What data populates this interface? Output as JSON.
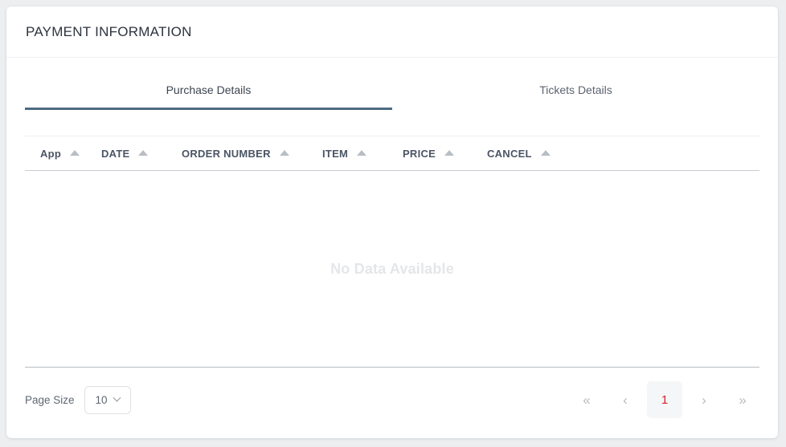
{
  "card": {
    "title": "PAYMENT INFORMATION"
  },
  "tabs": [
    {
      "label": "Purchase Details",
      "active": true
    },
    {
      "label": "Tickets Details",
      "active": false
    }
  ],
  "table": {
    "columns": [
      {
        "label": "App",
        "sort_icon": "sort-ascending-icon"
      },
      {
        "label": "DATE",
        "sort_icon": "sort-ascending-icon"
      },
      {
        "label": "ORDER NUMBER",
        "sort_icon": "sort-ascending-icon"
      },
      {
        "label": "ITEM",
        "sort_icon": "sort-ascending-icon"
      },
      {
        "label": "PRICE",
        "sort_icon": "sort-ascending-icon"
      },
      {
        "label": "CANCEL",
        "sort_icon": "sort-ascending-icon"
      }
    ],
    "rows": [],
    "empty_message": "No Data Available"
  },
  "footer": {
    "page_size_label": "Page Size",
    "page_size_value": "10",
    "page_size_icon": "chevron-down-icon",
    "pagination": {
      "first_label": "«",
      "prev_label": "‹",
      "current_page": "1",
      "next_label": "›",
      "last_label": "»"
    }
  },
  "colors": {
    "page_background": "#eceef0",
    "card_background": "#ffffff",
    "active_tab_underline": "#4b6b82",
    "title_text": "#2d333f",
    "header_text": "#4b5565",
    "empty_text": "#e4e6e9",
    "active_page_text": "#d0242a",
    "active_page_background": "#f5f6f7",
    "sort_icon": "#b9bdc4"
  }
}
